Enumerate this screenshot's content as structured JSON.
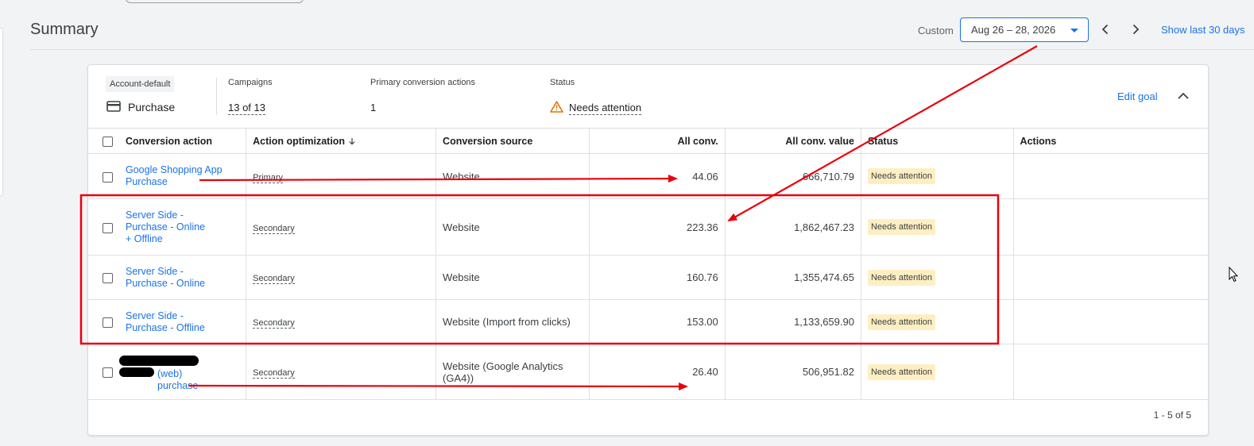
{
  "header": {
    "title": "Summary",
    "range_label": "Custom",
    "date_range": "Aug 26 – 28, 2026",
    "show_last": "Show last 30 days"
  },
  "goal": {
    "category": "Account-default",
    "name": "Purchase",
    "campaigns_label": "Campaigns",
    "campaigns_value": "13 of 13",
    "primary_actions_label": "Primary conversion actions",
    "primary_actions_value": "1",
    "status_label": "Status",
    "status_value": "Needs attention",
    "edit_label": "Edit goal"
  },
  "table": {
    "columns": [
      "Conversion action",
      "Action optimization",
      "Conversion source",
      "All conv.",
      "All conv. value",
      "Status",
      "Actions"
    ],
    "rows": [
      {
        "action": "Google Shopping App Purchase",
        "optimization": "Primary",
        "source": "Website",
        "conv": "44.06",
        "value": "666,710.79",
        "status": "Needs attention"
      },
      {
        "action": "Server Side - Purchase - Online + Offline",
        "optimization": "Secondary",
        "source": "Website",
        "conv": "223.36",
        "value": "1,862,467.23",
        "status": "Needs attention"
      },
      {
        "action": "Server Side - Purchase - Online",
        "optimization": "Secondary",
        "source": "Website",
        "conv": "160.76",
        "value": "1,355,474.65",
        "status": "Needs attention"
      },
      {
        "action": "Server Side - Purchase - Offline",
        "optimization": "Secondary",
        "source": "Website (Import from clicks)",
        "conv": "153.00",
        "value": "1,133,659.90",
        "status": "Needs attention"
      },
      {
        "action": "(web) purchase",
        "optimization": "Secondary",
        "source": "Website (Google Analytics (GA4))",
        "conv": "26.40",
        "value": "506,951.82",
        "status": "Needs attention"
      }
    ],
    "pagination": "1 - 5 of 5"
  },
  "colors": {
    "accent": "#1a73e8",
    "annotation": "#e8000b",
    "warning": "#e37400",
    "badge_bg": "#feefc3"
  },
  "icons": [
    "chevron-left-icon",
    "chevron-right-icon",
    "dropdown-caret-icon",
    "credit-card-icon",
    "warning-icon",
    "chevron-up-icon",
    "sort-arrow-down-icon",
    "mouse-cursor-icon"
  ]
}
